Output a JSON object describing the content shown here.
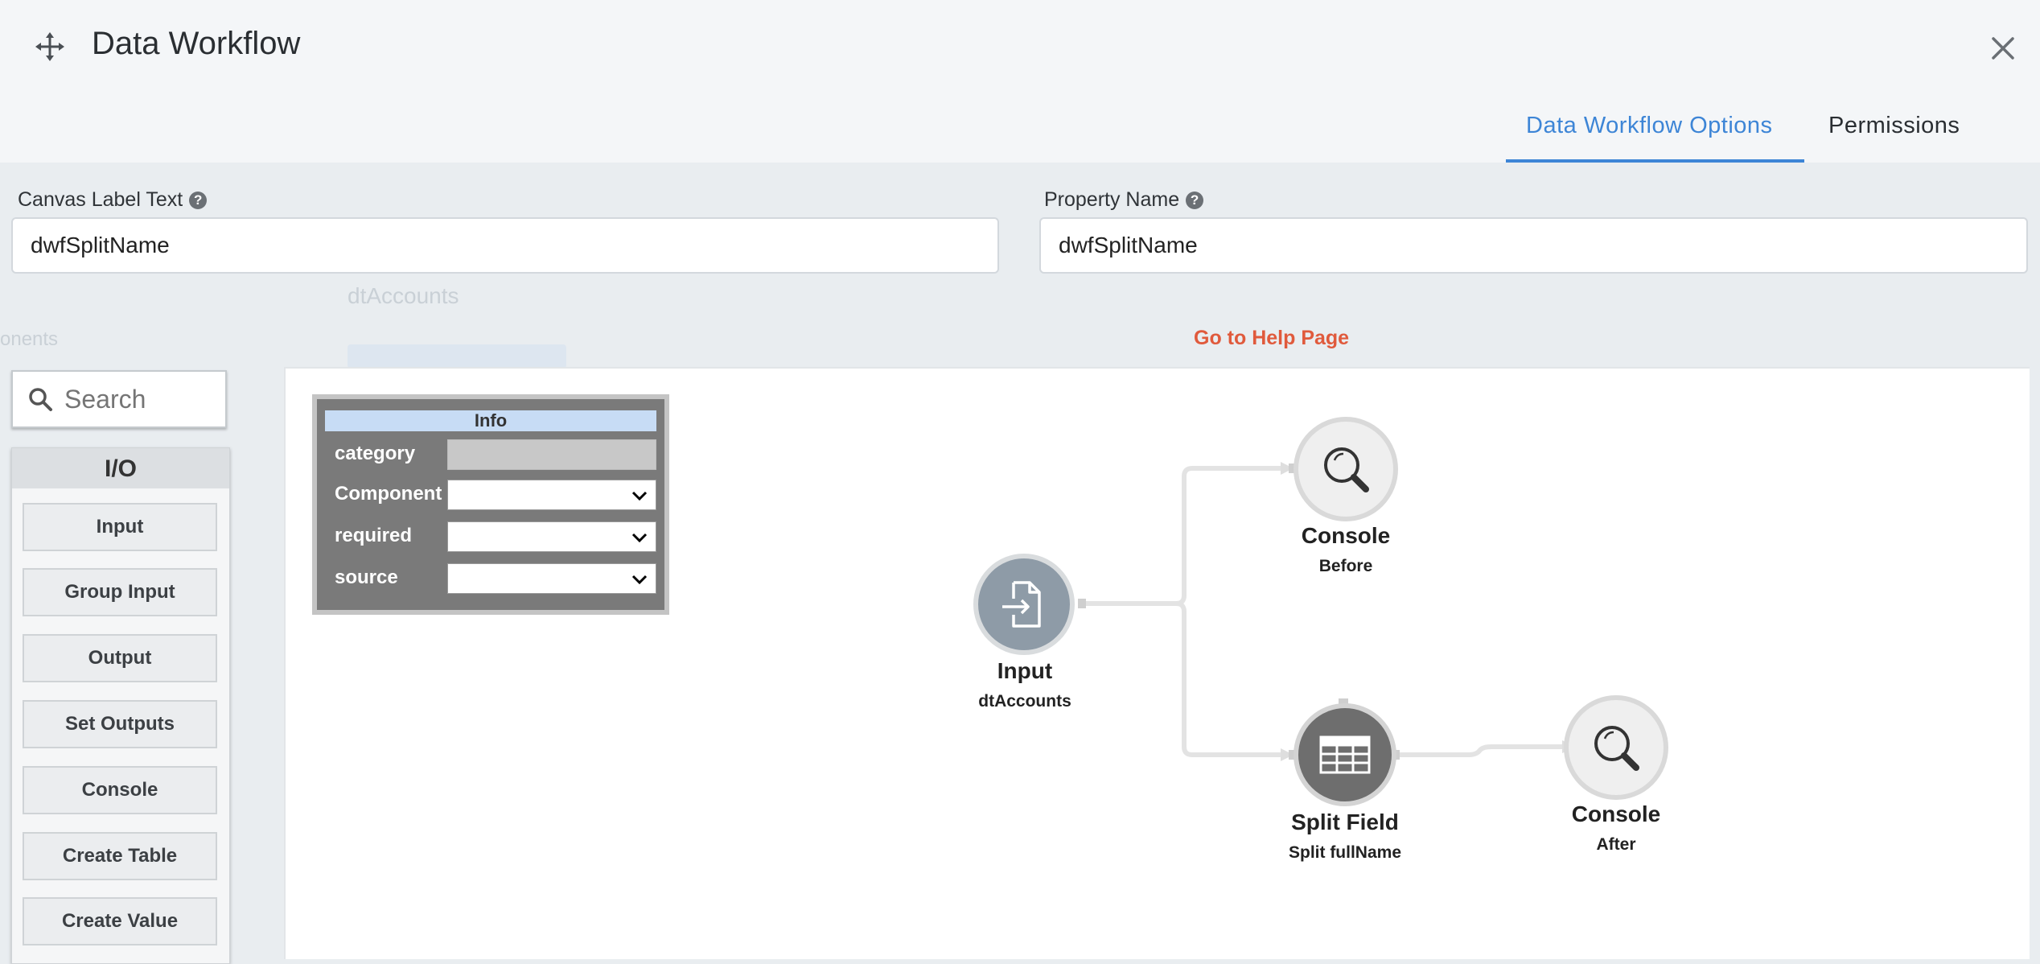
{
  "header": {
    "title": "Data Workflow",
    "tabs": [
      {
        "label": "Data Workflow Options",
        "active": true
      },
      {
        "label": "Permissions",
        "active": false
      }
    ]
  },
  "form": {
    "canvas_label": {
      "label": "Canvas Label Text",
      "value": "dwfSplitName"
    },
    "property_name": {
      "label": "Property Name",
      "value": "dwfSplitName"
    },
    "help_link": "Go to Help Page"
  },
  "background": {
    "ghost_text": "dtAccounts",
    "ghost_side_text": "onents"
  },
  "palette": {
    "search_placeholder": "Search",
    "section": "I/O",
    "items": [
      "Input",
      "Group Input",
      "Output",
      "Set Outputs",
      "Console",
      "Create Table",
      "Create Value"
    ]
  },
  "info_panel": {
    "title": "Info",
    "rows": [
      {
        "label": "category",
        "value": ""
      },
      {
        "label": "Component",
        "value": ""
      },
      {
        "label": "required",
        "value": ""
      },
      {
        "label": "source",
        "value": ""
      }
    ]
  },
  "nodes": {
    "input": {
      "title": "Input",
      "subtitle": "dtAccounts",
      "icon": "file-import-icon"
    },
    "console_before": {
      "title": "Console",
      "subtitle": "Before",
      "icon": "magnifier-icon"
    },
    "split_field": {
      "title": "Split Field",
      "subtitle": "Split fullName",
      "icon": "table-icon"
    },
    "console_after": {
      "title": "Console",
      "subtitle": "After",
      "icon": "magnifier-icon"
    }
  },
  "colors": {
    "accent": "#3d85d6",
    "help_link": "#e05a3c",
    "node_input": "#8e9ba7",
    "node_split": "#6e6e6e"
  }
}
